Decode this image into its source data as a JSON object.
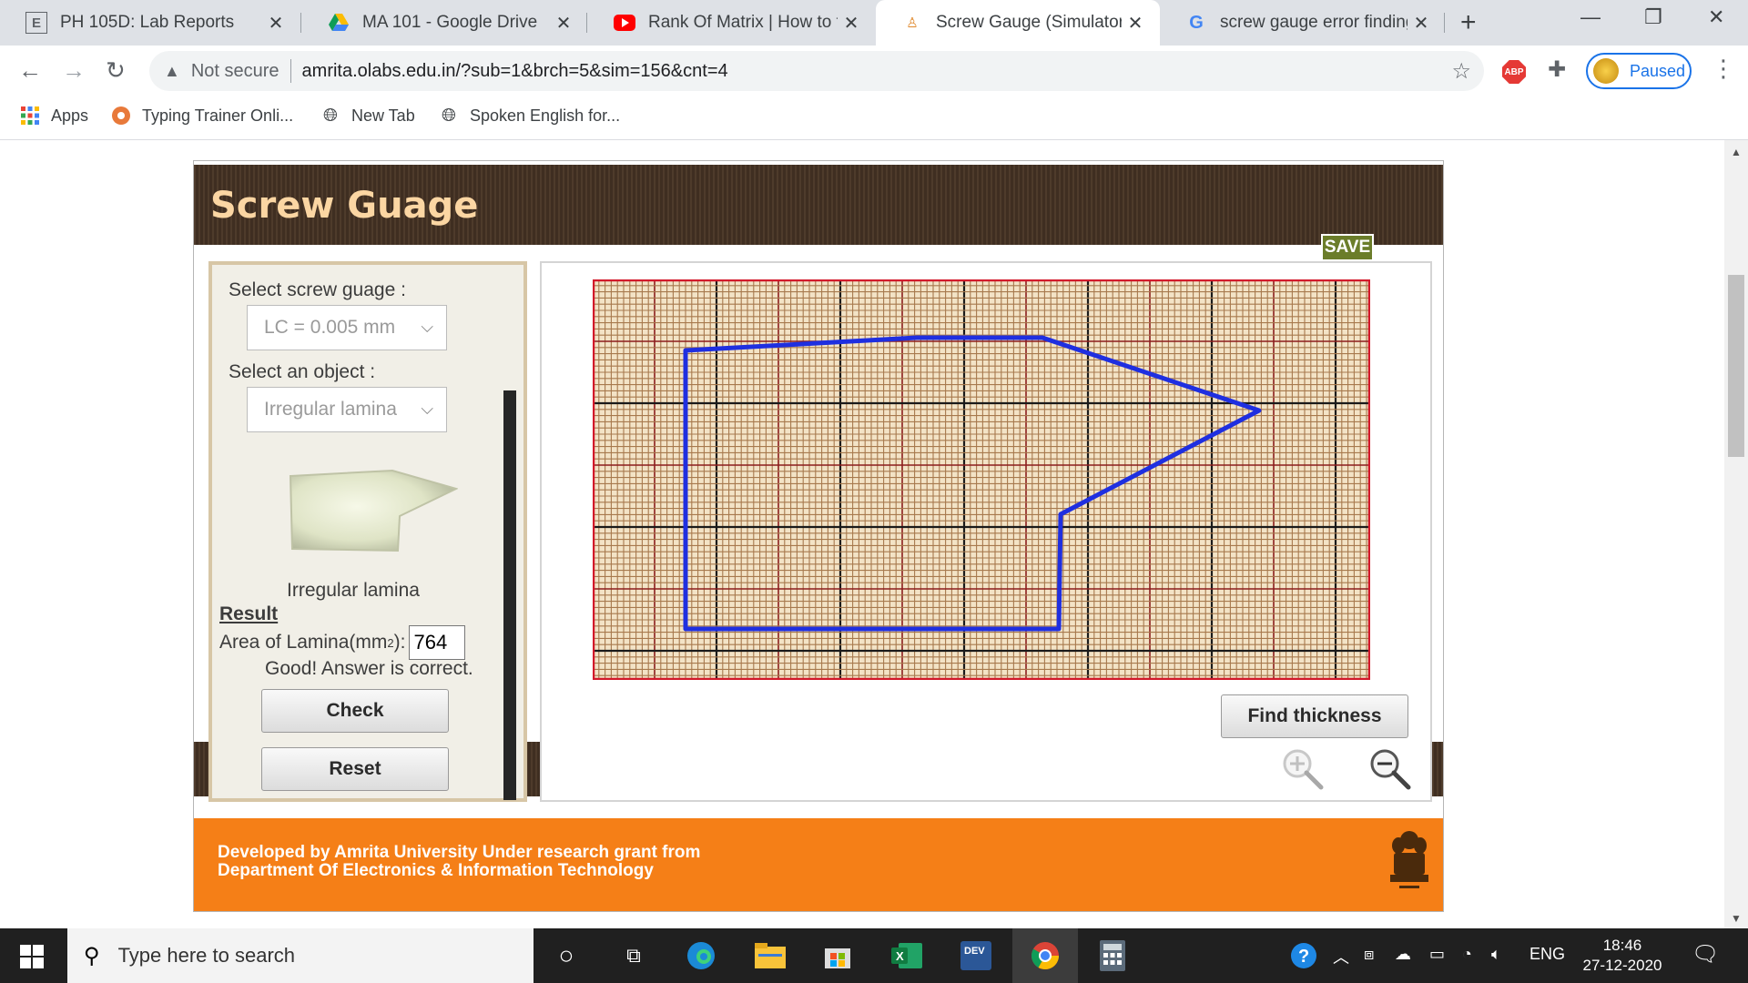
{
  "browser": {
    "tabs": [
      {
        "title": "PH 105D: Lab Reports",
        "icon": "e-logo-icon"
      },
      {
        "title": "MA 101 - Google Drive",
        "icon": "google-drive-icon"
      },
      {
        "title": "Rank Of Matrix | How to fin",
        "icon": "youtube-icon"
      },
      {
        "title": "Screw Gauge (Simulator) : C",
        "icon": "olabs-icon",
        "active": true
      },
      {
        "title": "screw gauge error finding -",
        "icon": "google-icon"
      }
    ],
    "security_label": "Not secure",
    "url": "amrita.olabs.edu.in/?sub=1&brch=5&sim=156&cnt=4",
    "abp_label": "ABP",
    "profile_label": "Paused",
    "bookmarks": [
      {
        "label": "Apps"
      },
      {
        "label": "Typing Trainer Onli..."
      },
      {
        "label": "New Tab"
      },
      {
        "label": "Spoken English for..."
      }
    ]
  },
  "app": {
    "title": "Screw Guage",
    "save_label": "SAVE",
    "select_gauge_label": "Select screw guage :",
    "gauge_value": "LC = 0.005 mm",
    "select_object_label": "Select an object :",
    "object_value": "Irregular lamina",
    "object_name": "Irregular lamina",
    "result_heading": "Result",
    "area_label": "Area of Lamina(mm",
    "area_superscript": "2",
    "area_label_end": "):",
    "area_value": "764",
    "feedback": "Good! Answer is correct.",
    "check_label": "Check",
    "reset_label": "Reset",
    "find_thickness_label": "Find thickness",
    "zoom_in_icon": "zoom-in-icon",
    "zoom_out_icon": "zoom-out-icon",
    "lamina_outline_color": "#1f2fe0",
    "footer_line1": "Developed by Amrita University Under research grant from",
    "footer_line2": "Department Of Electronics & Information Technology"
  },
  "taskbar": {
    "search_placeholder": "Type here to search",
    "language": "ENG",
    "time": "18:46",
    "date": "27-12-2020"
  },
  "colors": {
    "header_brown": "#4e3b2b",
    "title_cream": "#fbd6a3",
    "footer_orange": "#f57f17",
    "save_green": "#6b7d2a"
  }
}
